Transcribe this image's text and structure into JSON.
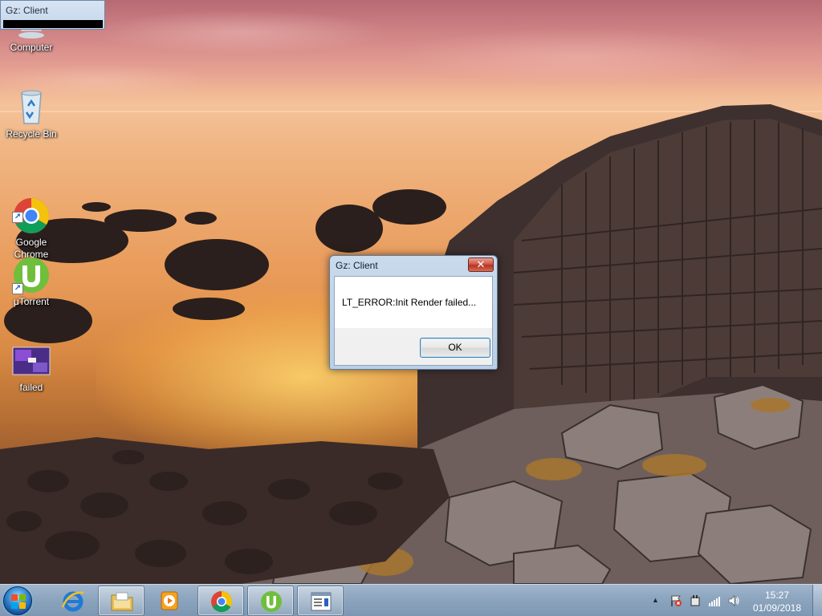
{
  "desktop": {
    "icons": [
      {
        "label": "Computer"
      },
      {
        "label": "Recycle Bin"
      },
      {
        "label": "Google\nChrome"
      },
      {
        "label": "μTorrent"
      },
      {
        "label": "failed"
      }
    ]
  },
  "mini_window": {
    "title": "Gz: Client"
  },
  "dialog": {
    "title": "Gz: Client",
    "close_label": "✕",
    "message": "LT_ERROR:Init Render failed...",
    "ok_label": "OK"
  },
  "taskbar": {
    "buttons": [
      {
        "name": "Internet Explorer",
        "icon": "internet-explorer-icon"
      },
      {
        "name": "Windows Explorer",
        "icon": "folder-icon"
      },
      {
        "name": "Windows Media Player",
        "icon": "media-player-icon"
      },
      {
        "name": "Google Chrome",
        "icon": "chrome-icon"
      },
      {
        "name": "μTorrent",
        "icon": "utorrent-icon"
      },
      {
        "name": "Gz: Client",
        "icon": "app-window-icon"
      }
    ],
    "tray": {
      "icons": [
        "show-hidden-icons-icon",
        "action-center-flag-icon",
        "device-icon",
        "network-signal-icon",
        "volume-icon"
      ]
    },
    "clock": {
      "time": "15:27",
      "date": "01/09/2018"
    }
  },
  "colors": {
    "taskbar": "#8ea6bf",
    "dialog_frame": "#c9daec",
    "close_button": "#c4402c"
  }
}
